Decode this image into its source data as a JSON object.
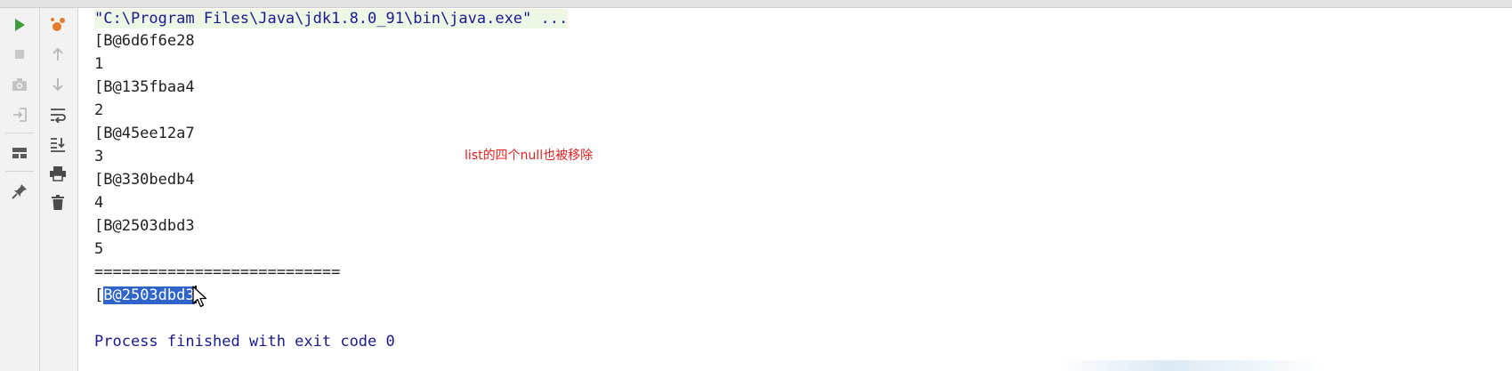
{
  "console": {
    "command": "\"C:\\Program Files\\Java\\jdk1.8.0_91\\bin\\java.exe\" ...",
    "lines": [
      "[B@6d6f6e28",
      "1",
      "[B@135fbaa4",
      "2",
      "[B@45ee12a7",
      "3",
      "[B@330bedb4",
      "4",
      "[B@2503dbd3",
      "5",
      "==========================="
    ],
    "selected_line": {
      "prefix": "[",
      "selected": "B@2503dbd",
      "suffix": "3"
    },
    "process_finished": "Process finished with exit code 0"
  },
  "annotation": "list的四个null也被移除",
  "icons": {
    "left_toolbar": [
      "run-icon",
      "stop-icon",
      "camera-icon",
      "login-icon",
      "layout-icon",
      "pin-icon"
    ],
    "right_toolbar": [
      "debug-icon",
      "up-arrow-icon",
      "down-arrow-icon",
      "soft-wrap-icon",
      "scroll-to-end-icon",
      "print-icon",
      "trash-icon"
    ]
  },
  "colors": {
    "run_green": "#3c9e3c",
    "selection": "#2f65ca",
    "annotation_red": "#e02020",
    "process_blue": "#1a1a8c"
  }
}
